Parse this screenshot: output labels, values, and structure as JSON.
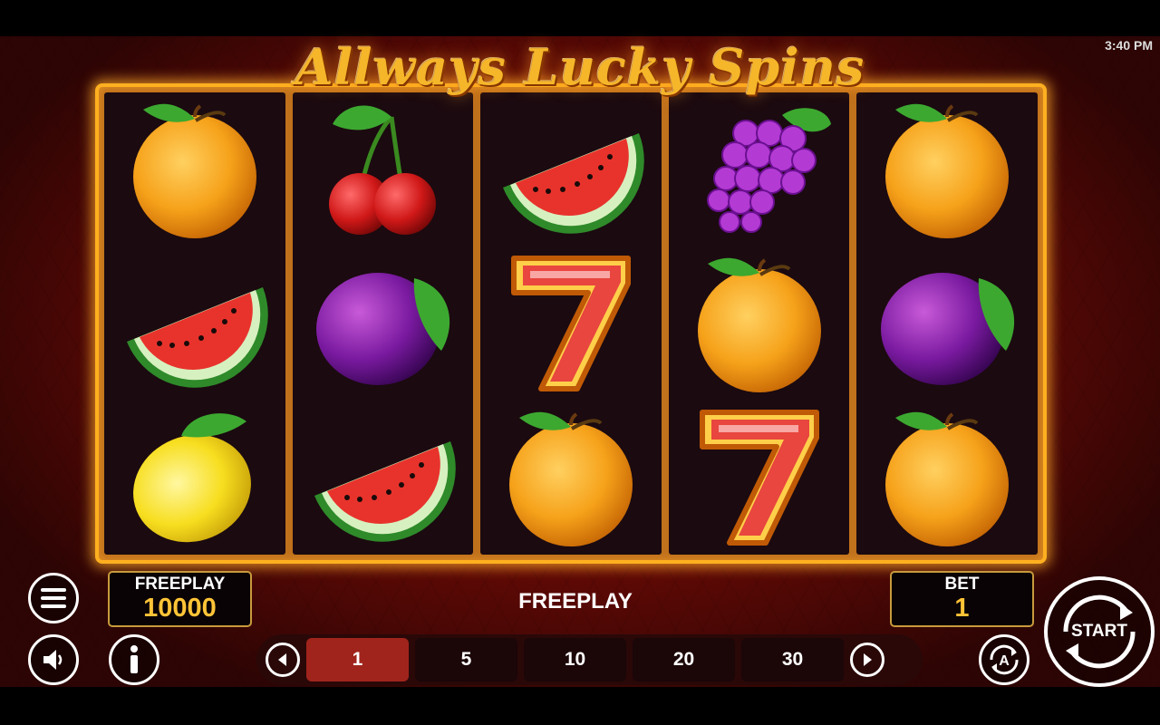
{
  "game": {
    "title": "Allways Lucky Spins",
    "clock": "3:40 PM"
  },
  "reels": [
    [
      "orange",
      "watermelon",
      "lemon"
    ],
    [
      "cherry",
      "plum",
      "watermelon"
    ],
    [
      "watermelon",
      "seven",
      "orange"
    ],
    [
      "grapes",
      "orange",
      "seven"
    ],
    [
      "orange",
      "plum",
      "orange"
    ]
  ],
  "balance": {
    "label": "FREEPLAY",
    "value": "10000"
  },
  "status": "FREEPLAY",
  "bet": {
    "label": "BET",
    "value": "1"
  },
  "bet_options": [
    "1",
    "5",
    "10",
    "20",
    "30"
  ],
  "selected_bet": "1",
  "start": {
    "label": "START"
  },
  "icons": {
    "menu": "hamburger-icon",
    "sound": "speaker-icon",
    "info": "info-icon",
    "autoplay": "autoplay-icon",
    "prev": "chevron-left-icon",
    "next": "chevron-right-icon"
  },
  "colors": {
    "frame": "#ffb020",
    "gold_text": "#ffc437",
    "selected_bet": "#a0241c",
    "background": "#5a0b06"
  }
}
